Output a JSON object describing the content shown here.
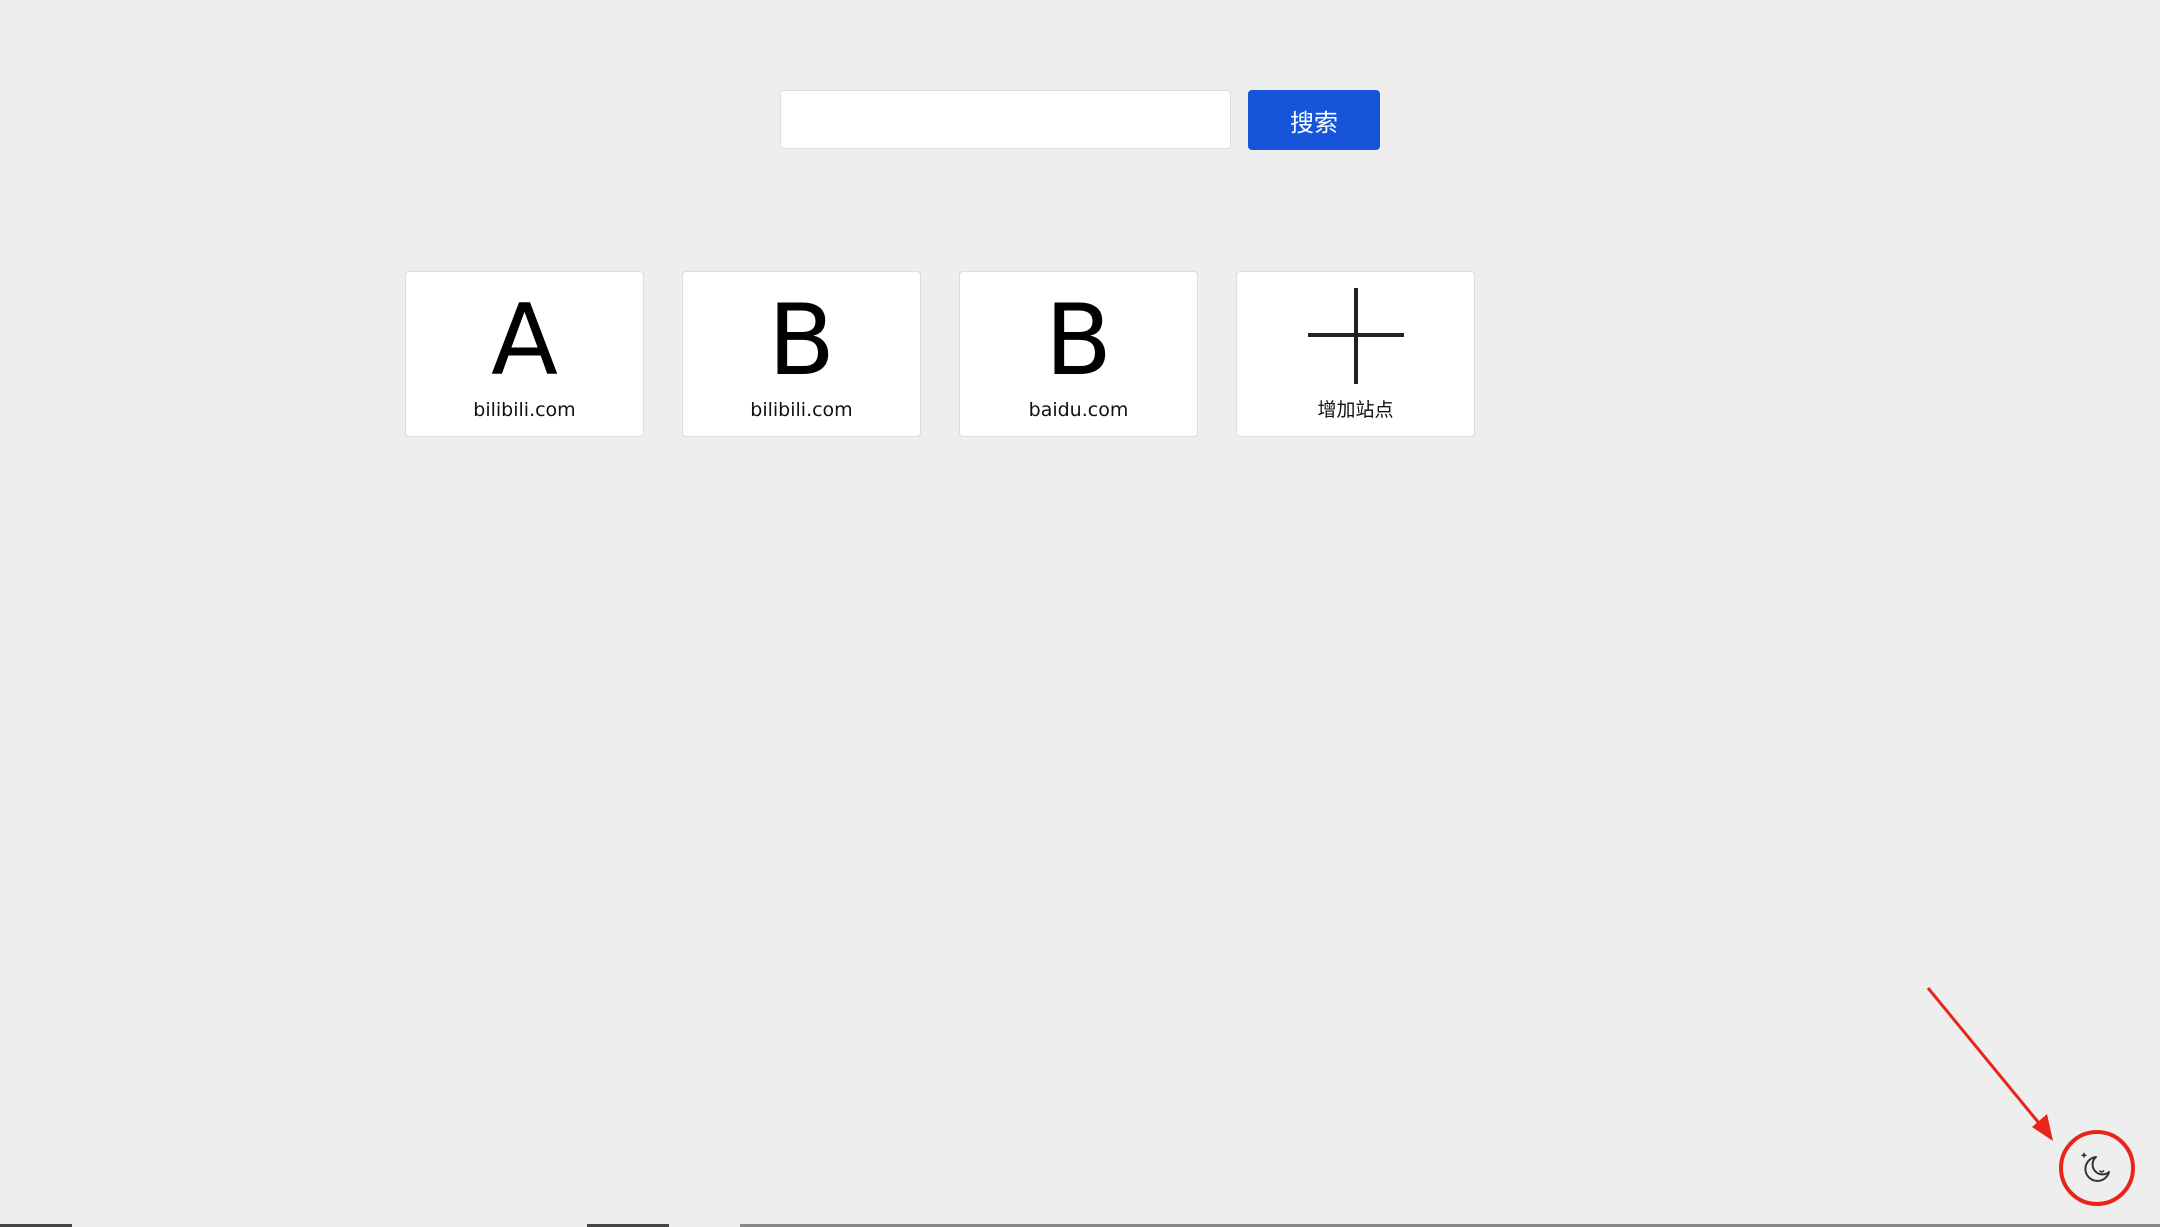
{
  "search": {
    "value": "",
    "placeholder": "",
    "button_label": "搜索"
  },
  "sites": [
    {
      "letter": "A",
      "label": "bilibili.com"
    },
    {
      "letter": "B",
      "label": "bilibili.com"
    },
    {
      "letter": "B",
      "label": "baidu.com"
    }
  ],
  "add_site": {
    "label": "增加站点"
  },
  "theme_toggle": {
    "icon": "moon-icon"
  },
  "colors": {
    "background": "#eeeeee",
    "accent": "#1655d9",
    "annotation": "#e8241b"
  }
}
